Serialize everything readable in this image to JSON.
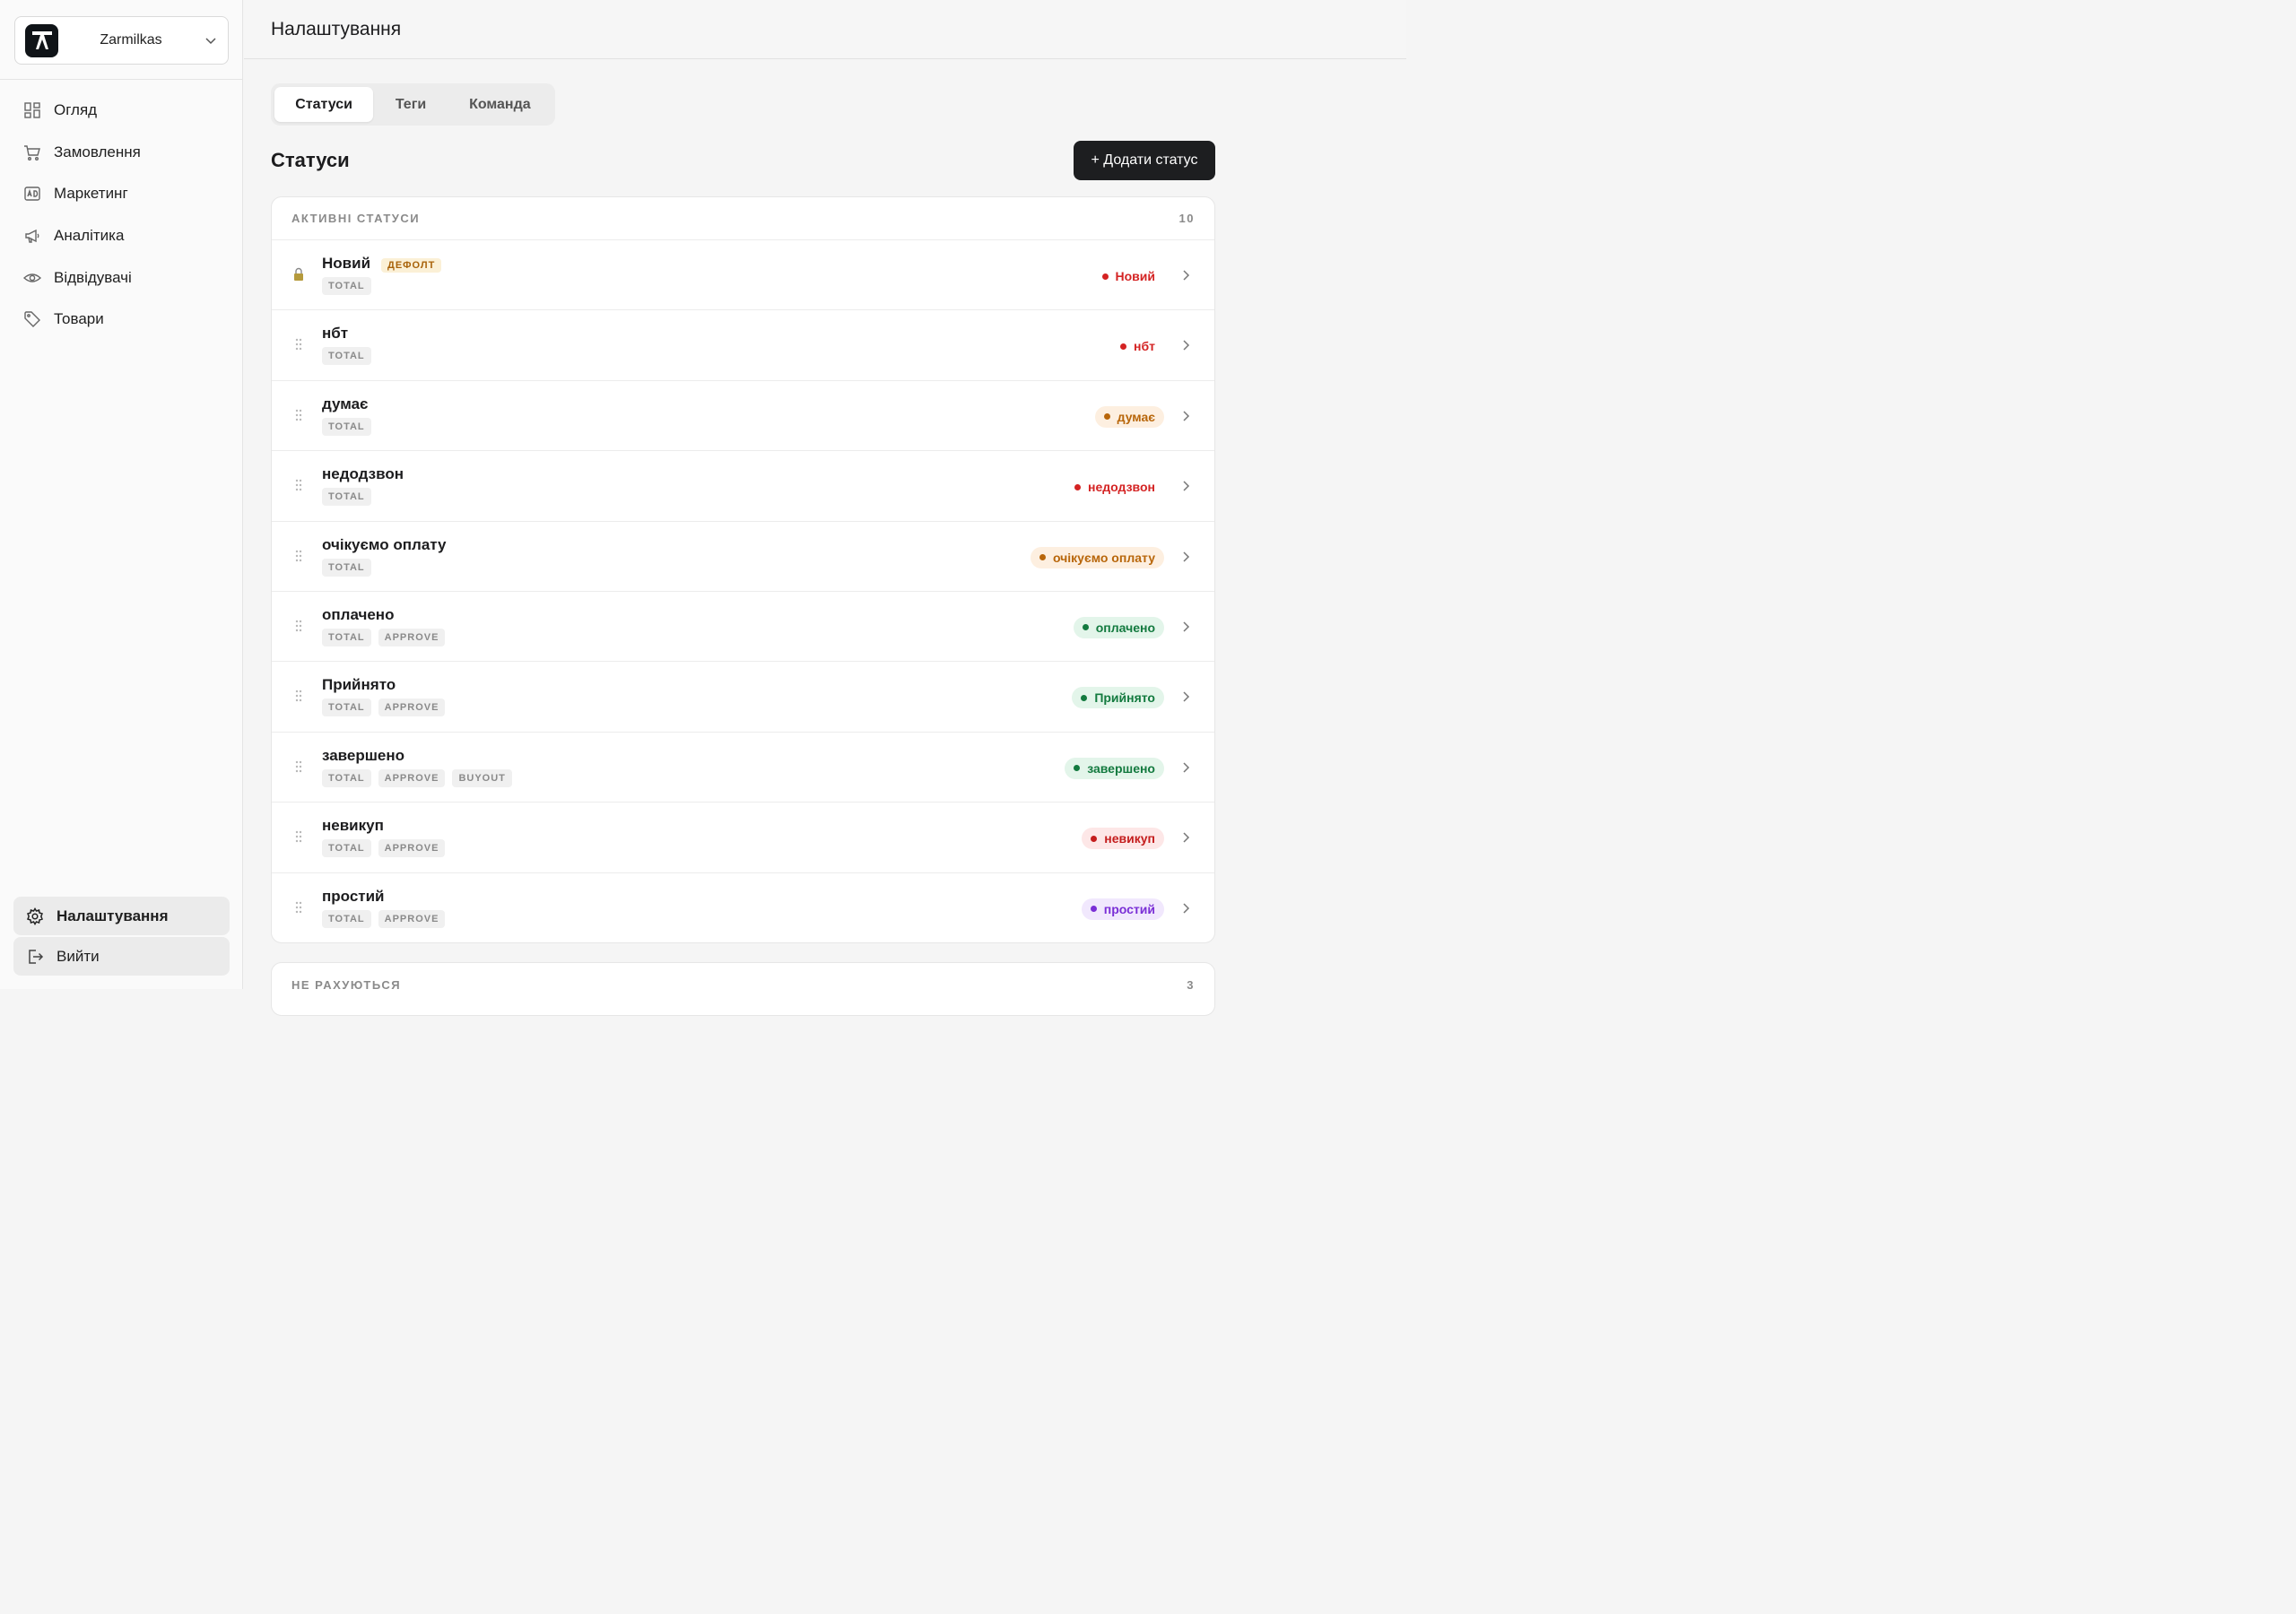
{
  "workspace": {
    "name": "Zarmilkas"
  },
  "nav": [
    {
      "label": "Огляд",
      "icon": "dashboard-icon"
    },
    {
      "label": "Замовлення",
      "icon": "cart-icon"
    },
    {
      "label": "Маркетинг",
      "icon": "ad-icon"
    },
    {
      "label": "Аналітика",
      "icon": "megaphone-icon"
    },
    {
      "label": "Відвідувачі",
      "icon": "eye-icon"
    },
    {
      "label": "Товари",
      "icon": "tag-icon"
    }
  ],
  "bottom_nav": {
    "settings": "Налаштування",
    "logout": "Вийти"
  },
  "header": {
    "title": "Налаштування"
  },
  "tabs": [
    {
      "label": "Статуси",
      "active": true
    },
    {
      "label": "Теги",
      "active": false
    },
    {
      "label": "Команда",
      "active": false
    }
  ],
  "section": {
    "title": "Статуси",
    "add_button": "+ Додати статус"
  },
  "active_card": {
    "heading": "АКТИВНІ СТАТУСИ",
    "count": "10",
    "rows": [
      {
        "name": "Новий",
        "badge": "ДЕФОЛТ",
        "locked": true,
        "tags": [
          "TOTAL"
        ],
        "pill": "Новий",
        "color": "#d42323",
        "bg": ""
      },
      {
        "name": "нбт",
        "tags": [
          "TOTAL"
        ],
        "pill": "нбт",
        "color": "#d42323",
        "bg": ""
      },
      {
        "name": "думає",
        "tags": [
          "TOTAL"
        ],
        "pill": "думає",
        "color": "#b8660a",
        "bg": "#fdefe0"
      },
      {
        "name": "недодзвон",
        "tags": [
          "TOTAL"
        ],
        "pill": "недодзвон",
        "color": "#d42323",
        "bg": ""
      },
      {
        "name": "очікуємо оплату",
        "tags": [
          "TOTAL"
        ],
        "pill": "очікуємо оплату",
        "color": "#b8660a",
        "bg": "#fdefe0"
      },
      {
        "name": "оплачено",
        "tags": [
          "TOTAL",
          "APPROVE"
        ],
        "pill": "оплачено",
        "color": "#137a3f",
        "bg": "#e3f5ea"
      },
      {
        "name": "Прийнято",
        "tags": [
          "TOTAL",
          "APPROVE"
        ],
        "pill": "Прийнято",
        "color": "#137a3f",
        "bg": "#e3f5ea"
      },
      {
        "name": "завершено",
        "tags": [
          "TOTAL",
          "APPROVE",
          "BUYOUT"
        ],
        "pill": "завершено",
        "color": "#137a3f",
        "bg": "#e3f5ea"
      },
      {
        "name": "невикуп",
        "tags": [
          "TOTAL",
          "APPROVE"
        ],
        "pill": "невикуп",
        "color": "#c41d1d",
        "bg": "#fde7e7"
      },
      {
        "name": "простий",
        "tags": [
          "TOTAL",
          "APPROVE"
        ],
        "pill": "простий",
        "color": "#7a2fd6",
        "bg": "#f1e8fd"
      }
    ]
  },
  "inactive_card": {
    "heading": "НЕ РАХУЮТЬСЯ",
    "count": "3"
  }
}
